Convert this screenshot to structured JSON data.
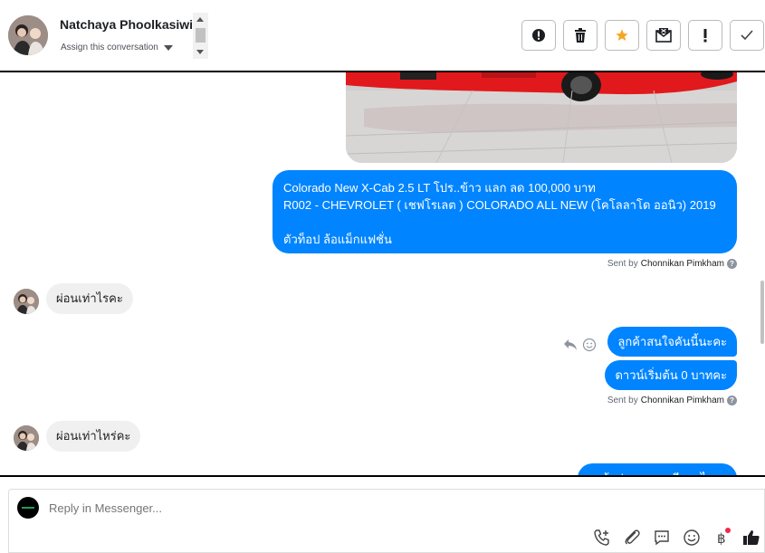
{
  "header": {
    "contact_name": "Natchaya Phoolkasiwit",
    "assign_label": "Assign this conversation",
    "toolbar": [
      {
        "name": "spam-button",
        "icon": "alert-circle-icon"
      },
      {
        "name": "delete-button",
        "icon": "trash-icon"
      },
      {
        "name": "star-button",
        "icon": "star-icon"
      },
      {
        "name": "mark-unread-button",
        "icon": "envelope-x-icon"
      },
      {
        "name": "follow-up-button",
        "icon": "exclamation-icon"
      },
      {
        "name": "done-button",
        "icon": "check-icon"
      }
    ]
  },
  "messages": {
    "outgoing_big_lines": [
      "Colorado New X-Cab 2.5 LT โปร..ข้าว แลก ลด 100,000 บาท",
      "R002 - CHEVROLET ( เชฟโรเลต ) COLORADO ALL NEW (โคโลลาโด ออนิว) 2019",
      "",
      "ตัวท็อป ล้อแม็กแฟชั่น"
    ],
    "sent_by_prefix": "Sent by",
    "sent_by_name": "Chonnikan Pimkham",
    "incoming_1": "ผ่อนเท่าไรคะ",
    "outgoing_1": "ลูกค้าสนใจคันนี้นะคะ",
    "outgoing_2": "ดาวน์เริ่มต้น 0 บาทคะ",
    "incoming_2": "ผ่อนเท่าไหร่คะ",
    "outgoing_3": "ลูกค้าประกอบอาชีพอะไรคะ"
  },
  "composer": {
    "placeholder": "Reply in Messenger...",
    "tools": [
      "call-add-icon",
      "attachment-icon",
      "saved-reply-icon",
      "emoji-icon",
      "baht-payment-icon",
      "like-icon"
    ]
  },
  "colors": {
    "accent": "#0084ff",
    "incoming_bg": "#f0f0f0",
    "star": "#f5a623"
  }
}
